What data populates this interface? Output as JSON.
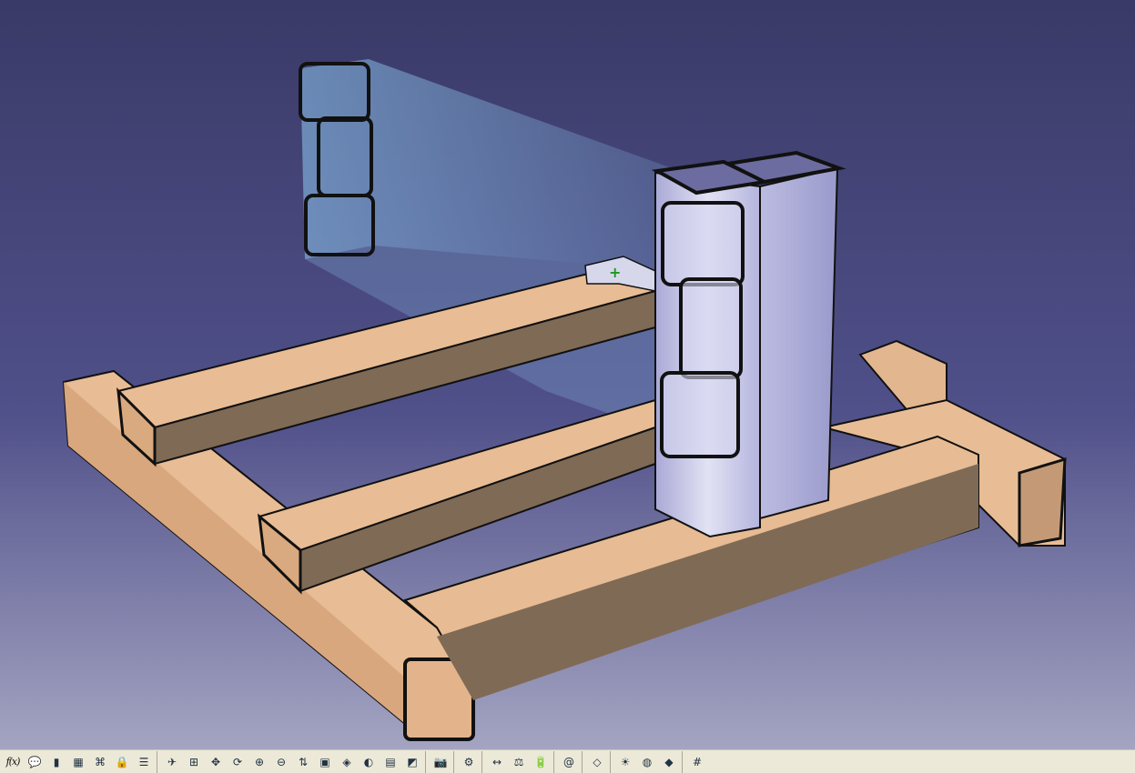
{
  "app": {
    "accent_background_top": "#3b3b6a",
    "accent_background_bottom": "#9a9ab8",
    "wood_color": "#e5b992",
    "wood_shadow": "#7a6653",
    "steel_color": "#c9c9e6",
    "preview_color": "#7fb7e0"
  },
  "viewport": {
    "compass_marker": "+"
  },
  "toolbar": {
    "formula_label": "f(x)",
    "groups": [
      [
        "formula-icon",
        "comment-icon",
        "stack-icon",
        "table-icon",
        "knowledge-icon",
        "lock-icon",
        "catalog-icon"
      ],
      [
        "fly-mode-icon",
        "fit-all-icon",
        "pan-icon",
        "rotate-icon",
        "zoom-in-icon",
        "zoom-out-icon",
        "normal-view-icon",
        "multi-view-icon",
        "iso-view-icon",
        "shading-icon",
        "hide-show-icon",
        "swap-view-icon"
      ],
      [
        "capture-icon"
      ],
      [
        "measure-icon"
      ],
      [
        "measure-between-icon",
        "inertia-icon",
        "battery-icon"
      ],
      [
        "spiral-icon"
      ],
      [
        "surface-icon"
      ],
      [
        "render-icon",
        "sphere-icon",
        "color-icon"
      ],
      [
        "grid-icon"
      ]
    ]
  }
}
